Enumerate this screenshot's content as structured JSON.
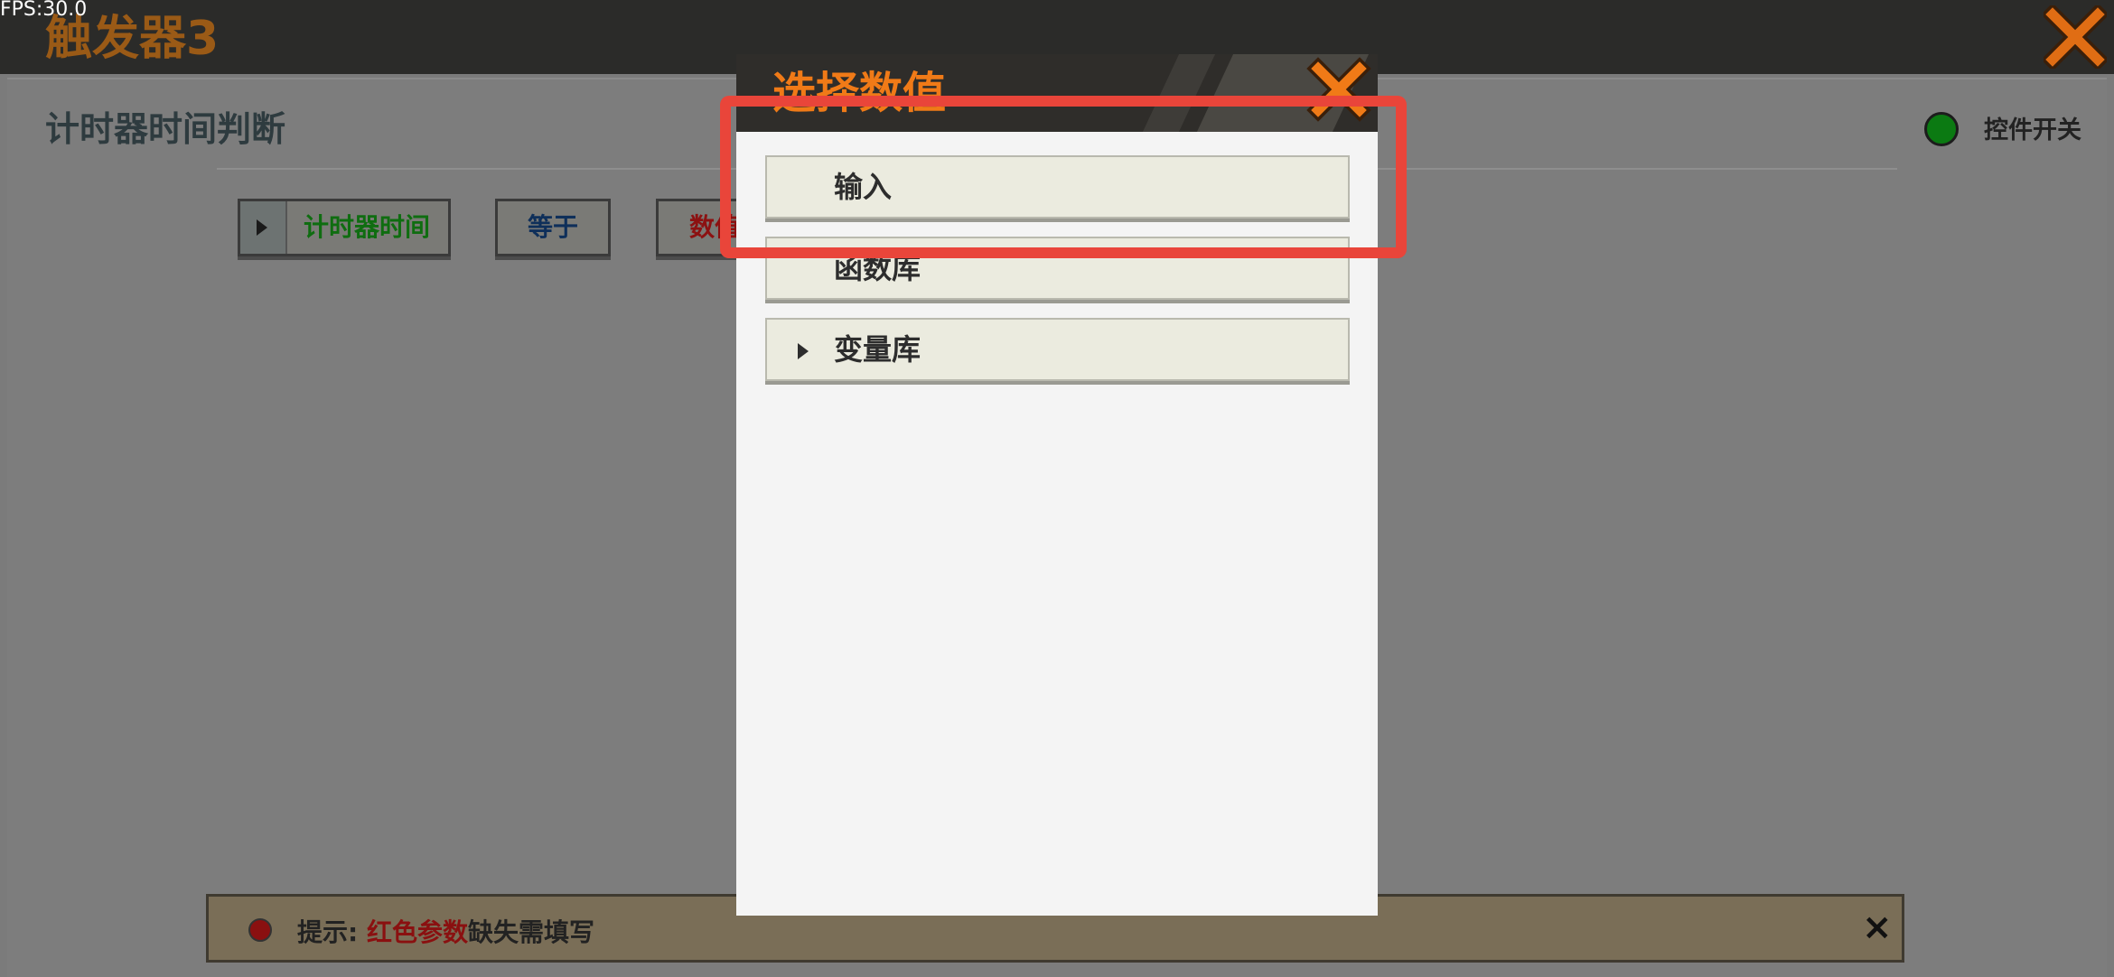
{
  "fps": "FPS:30.0",
  "window": {
    "title": "触发器3"
  },
  "condition": {
    "title": "计时器时间判断",
    "switch_label": "控件开关",
    "chips": {
      "timer": "计时器时间",
      "equal": "等于",
      "value": "数值"
    }
  },
  "hint": {
    "prefix": "提示: ",
    "highlight": "红色参数",
    "suffix": "缺失需填写",
    "close": "×"
  },
  "modal": {
    "title": "选择数值",
    "options": [
      {
        "label": "输入",
        "has_arrow": false
      },
      {
        "label": "函数库",
        "has_arrow": false
      },
      {
        "label": "变量库",
        "has_arrow": true
      }
    ]
  },
  "colors": {
    "accent": "#f07a17",
    "highlight_box": "#e9453a",
    "switch_on": "#0b7a12"
  },
  "icons": {
    "close": "close-icon",
    "expand": "triangle-right-icon"
  }
}
